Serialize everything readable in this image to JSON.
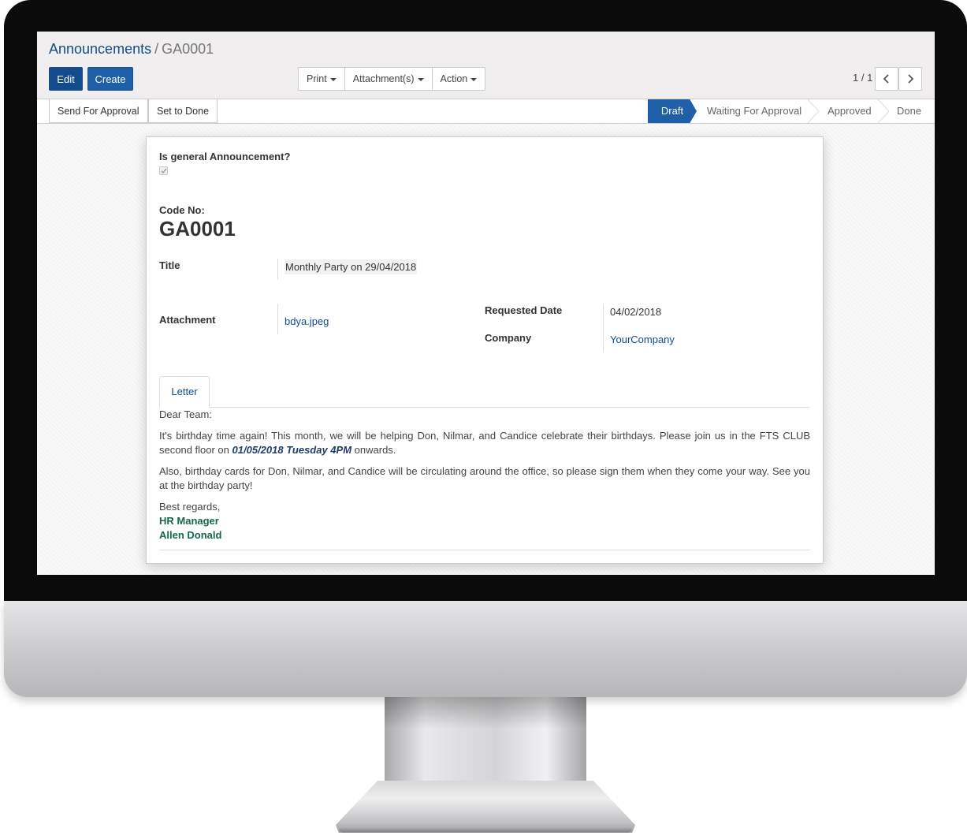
{
  "breadcrumb": {
    "parent": "Announcements",
    "separator": "/",
    "current": "GA0001"
  },
  "buttons": {
    "edit": "Edit",
    "create": "Create"
  },
  "sidebar": {
    "print": "Print",
    "attachments": "Attachment(s)",
    "action": "Action"
  },
  "pager": {
    "value": "1 / 1"
  },
  "statusbar": {
    "send_for_approval": "Send For Approval",
    "set_to_done": "Set to Done",
    "stages": [
      "Draft",
      "Waiting For Approval",
      "Approved",
      "Done"
    ],
    "active_stage": "Draft"
  },
  "form": {
    "general_label": "Is general Announcement?",
    "general_checked": true,
    "code_label": "Code No:",
    "code_value": "GA0001",
    "title_label": "Title",
    "title_value": "Monthly Party on 29/04/2018",
    "attachment_label": "Attachment",
    "attachment_value": "bdya.jpeg",
    "requested_date_label": "Requested Date",
    "requested_date_value": "04/02/2018",
    "company_label": "Company",
    "company_value": "YourCompany"
  },
  "tabs": [
    "Letter"
  ],
  "letter": {
    "greeting": "Dear Team:",
    "para1_before": "It's birthday time again! This month, we will be helping Don, Nilmar, and Candice celebrate their birthdays. Please join us in the FTS CLUB second floor on ",
    "para1_date": "01/05/2018 Tuesday 4PM",
    "para1_after": " onwards.",
    "para2": "Also, birthday cards for Don, Nilmar, and Candice will be circulating around the office, so please sign them when they come your way. See you at the birthday party!",
    "closing": "Best regards,",
    "sign_role": "HR Manager",
    "sign_name": "Allen Donald"
  },
  "colors": {
    "primary": "#1e5fa8",
    "link": "#124c8c",
    "signature": "#16684a"
  },
  "icons": {
    "pager_prev": "chevron-left-icon",
    "pager_next": "chevron-right-icon",
    "checkbox": "check-icon"
  }
}
